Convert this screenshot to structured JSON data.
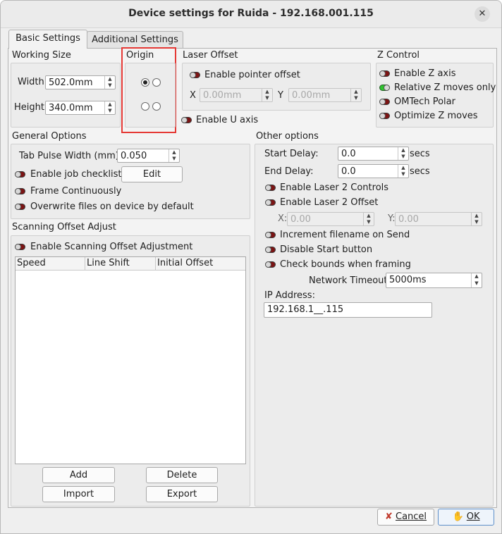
{
  "window": {
    "title": "Device settings for Ruida - 192.168.001.115",
    "close_glyph": "✕"
  },
  "tabs": [
    {
      "label": "Basic Settings"
    },
    {
      "label": "Additional Settings"
    }
  ],
  "working_size": {
    "title": "Working Size",
    "width_label": "Width",
    "width_value": "502.0mm",
    "height_label": "Height",
    "height_value": "340.0mm"
  },
  "origin": {
    "title": "Origin",
    "selected": "top-left"
  },
  "laser_offset": {
    "title": "Laser Offset",
    "enable_label": "Enable pointer offset",
    "x_label": "X",
    "x_value": "0.00mm",
    "y_label": "Y",
    "y_value": "0.00mm",
    "u_axis_label": "Enable U axis"
  },
  "z_control": {
    "title": "Z Control",
    "items": [
      {
        "label": "Enable Z axis",
        "on": false
      },
      {
        "label": "Relative Z moves only",
        "on": true
      },
      {
        "label": "OMTech Polar",
        "on": false
      },
      {
        "label": "Optimize Z moves",
        "on": false
      }
    ]
  },
  "general": {
    "title": "General Options",
    "tab_pulse_label": "Tab Pulse Width (mm)",
    "tab_pulse_value": "0.050",
    "checklist_label": "Enable job checklist",
    "edit_label": "Edit",
    "frame_label": "Frame Continuously",
    "overwrite_label": "Overwrite files on device by default"
  },
  "scanning": {
    "title": "Scanning Offset Adjust",
    "enable_label": "Enable Scanning Offset Adjustment",
    "columns": [
      "Speed",
      "Line Shift",
      "Initial Offset"
    ],
    "add_label": "Add",
    "delete_label": "Delete",
    "import_label": "Import",
    "export_label": "Export"
  },
  "other": {
    "title": "Other options",
    "start_delay_label": "Start Delay:",
    "start_delay_value": "0.0",
    "end_delay_label": "End Delay:",
    "end_delay_value": "0.0",
    "secs": "secs",
    "laser2_controls_label": "Enable Laser 2 Controls",
    "laser2_offset_label": "Enable Laser 2 Offset",
    "x_label": "X:",
    "x_value": "0.00",
    "y_label": "Y:",
    "y_value": "0.00",
    "increment_label": "Increment filename on Send",
    "disable_start_label": "Disable Start button",
    "check_bounds_label": "Check bounds when framing",
    "network_timeout_label": "Network Timeout",
    "network_timeout_value": "5000ms",
    "ip_label": "IP Address:",
    "ip_value": "192.168.1__.115"
  },
  "footer": {
    "cancel_label": "Cancel",
    "ok_label": "OK"
  },
  "colors": {
    "highlight_red": "#e53935",
    "toggle_off": "#7d1414",
    "toggle_on": "#2fc42f"
  }
}
